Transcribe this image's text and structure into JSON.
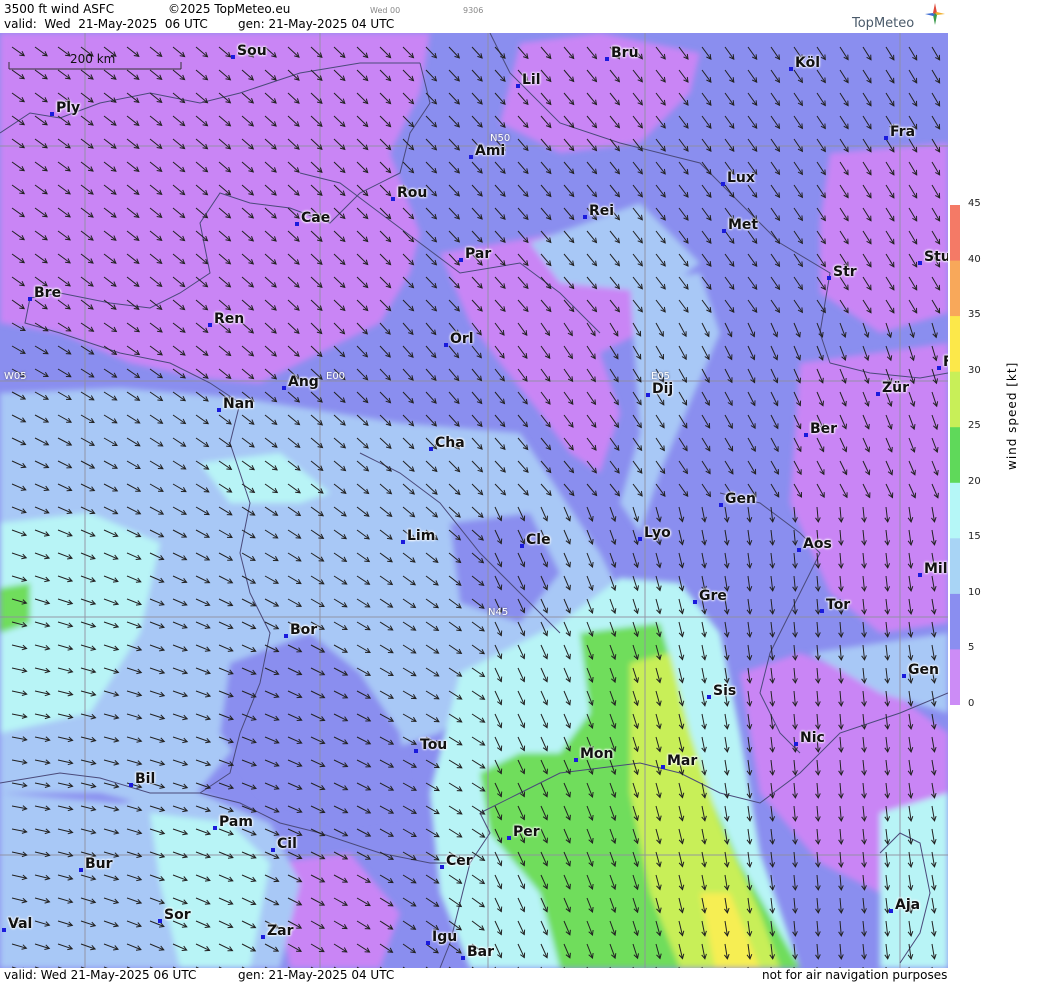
{
  "header": {
    "product": "3500 ft wind ASFC",
    "copyright": "©2025 TopMeteo.eu",
    "frame_day": "Wed 00",
    "frame_code": "9306",
    "valid": "valid:  Wed  21-May-2025  06 UTC",
    "gen": "gen: 21-May-2025 04 UTC"
  },
  "logo": {
    "text": "TopMeteo",
    "icon": "compass-star-icon"
  },
  "footer": {
    "valid": "valid:  Wed  21-May-2025  06 UTC",
    "gen": "gen: 21-May-2025 04 UTC",
    "notice": "not for air navigation purposes"
  },
  "scale_bar": {
    "label": "200 km"
  },
  "grid_labels": {
    "n50": "N50",
    "n45": "N45",
    "w05": "W05",
    "e00": "E00",
    "e05": "E05"
  },
  "cities": [
    {
      "name": "Sou"
    },
    {
      "name": "Lil"
    },
    {
      "name": "Bru"
    },
    {
      "name": "Köl"
    },
    {
      "name": "Ply"
    },
    {
      "name": "Ami"
    },
    {
      "name": "Fra"
    },
    {
      "name": "Lux"
    },
    {
      "name": "Rou"
    },
    {
      "name": "Cae"
    },
    {
      "name": "Rei"
    },
    {
      "name": "Met"
    },
    {
      "name": "Par"
    },
    {
      "name": "Stu"
    },
    {
      "name": "Bre"
    },
    {
      "name": "Str"
    },
    {
      "name": "Ren"
    },
    {
      "name": "Orl"
    },
    {
      "name": "Ang"
    },
    {
      "name": "Dij"
    },
    {
      "name": "Zür"
    },
    {
      "name": "Nan"
    },
    {
      "name": "Ber"
    },
    {
      "name": "Cha"
    },
    {
      "name": "Gen"
    },
    {
      "name": "Lim"
    },
    {
      "name": "Cle"
    },
    {
      "name": "Lyo"
    },
    {
      "name": "Aos"
    },
    {
      "name": "Mil"
    },
    {
      "name": "Gre"
    },
    {
      "name": "Tor"
    },
    {
      "name": "Bor"
    },
    {
      "name": "Sis"
    },
    {
      "name": "Gen"
    },
    {
      "name": "Nic"
    },
    {
      "name": "Tou"
    },
    {
      "name": "Mon"
    },
    {
      "name": "Mar"
    },
    {
      "name": "Bil"
    },
    {
      "name": "Pam"
    },
    {
      "name": "Cil"
    },
    {
      "name": "Per"
    },
    {
      "name": "Bur"
    },
    {
      "name": "Cer"
    },
    {
      "name": "Sor"
    },
    {
      "name": "Aja"
    },
    {
      "name": "Val"
    },
    {
      "name": "Zar"
    },
    {
      "name": "Igu"
    },
    {
      "name": "Bar"
    },
    {
      "name": "F"
    }
  ],
  "legend": {
    "title": "wind  speed  [kt]",
    "ticks": [
      "45",
      "40",
      "35",
      "30",
      "25",
      "20",
      "15",
      "10",
      "5",
      "0"
    ],
    "colors": [
      "#f47a66",
      "#f8a85a",
      "#fce84a",
      "#c8ef58",
      "#5fd95a",
      "#b5f7f7",
      "#a8d4f5",
      "#8a8ef0",
      "#cc8cf6"
    ]
  },
  "colors": {
    "violet": "#c985f5",
    "indigo": "#8a8eef",
    "blue": "#a8c8f6",
    "cyan": "#b8f4f6",
    "green": "#70dd5c",
    "yellowgreen": "#c8ef58",
    "yellow": "#f6ee52"
  }
}
